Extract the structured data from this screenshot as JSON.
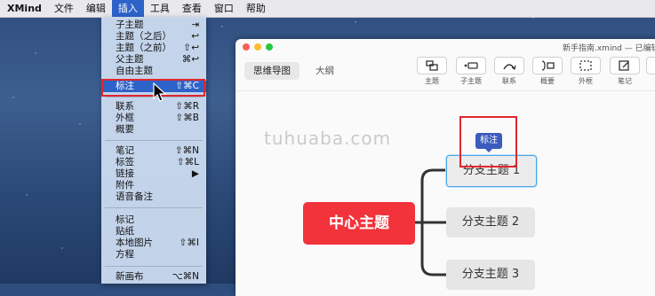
{
  "menubar": {
    "items": [
      "XMind",
      "文件",
      "编辑",
      "插入",
      "工具",
      "查看",
      "窗口",
      "帮助"
    ],
    "active_index": 3
  },
  "insert_menu": {
    "items": [
      {
        "label": "子主题",
        "shortcut": "⇥"
      },
      {
        "label": "主题（之后）",
        "shortcut": "↩"
      },
      {
        "label": "主题（之前）",
        "shortcut": "⇧↩"
      },
      {
        "label": "父主题",
        "shortcut": "⌘↩"
      },
      {
        "label": "自由主题",
        "shortcut": ""
      },
      {
        "label": "标注",
        "shortcut": "⇧⌘C"
      },
      {
        "label": "联系",
        "shortcut": "⇧⌘R"
      },
      {
        "label": "外框",
        "shortcut": "⇧⌘B"
      },
      {
        "label": "概要",
        "shortcut": ""
      },
      {
        "label": "笔记",
        "shortcut": "⇧⌘N"
      },
      {
        "label": "标签",
        "shortcut": "⇧⌘L"
      },
      {
        "label": "链接",
        "shortcut": "▶"
      },
      {
        "label": "附件",
        "shortcut": ""
      },
      {
        "label": "语音备注",
        "shortcut": ""
      },
      {
        "label": "标记",
        "shortcut": ""
      },
      {
        "label": "贴纸",
        "shortcut": ""
      },
      {
        "label": "本地图片",
        "shortcut": "⇧⌘I"
      },
      {
        "label": "方程",
        "shortcut": ""
      },
      {
        "label": "新画布",
        "shortcut": "⌥⌘N"
      }
    ],
    "highlighted_index": 5
  },
  "window": {
    "title": "新手指南.xmind — 已编辑",
    "tabs": [
      "思维导图",
      "大纲"
    ],
    "tools": [
      {
        "label": "主题",
        "icon": "topic-icon"
      },
      {
        "label": "子主题",
        "icon": "subtopic-icon"
      },
      {
        "label": "联系",
        "icon": "relationship-icon"
      },
      {
        "label": "概要",
        "icon": "summary-icon"
      },
      {
        "label": "外框",
        "icon": "boundary-icon"
      },
      {
        "label": "笔记",
        "icon": "note-icon"
      }
    ]
  },
  "mindmap": {
    "central": "中心主题",
    "branches": [
      "分支主题 1",
      "分支主题 2",
      "分支主题 3"
    ],
    "callout": "标注"
  },
  "watermark": "tuhuaba.com",
  "colors": {
    "accent": "#2d62c9",
    "central": "#f2333b",
    "callout": "#3c5bbd",
    "highlight_box": "#e0262e"
  }
}
